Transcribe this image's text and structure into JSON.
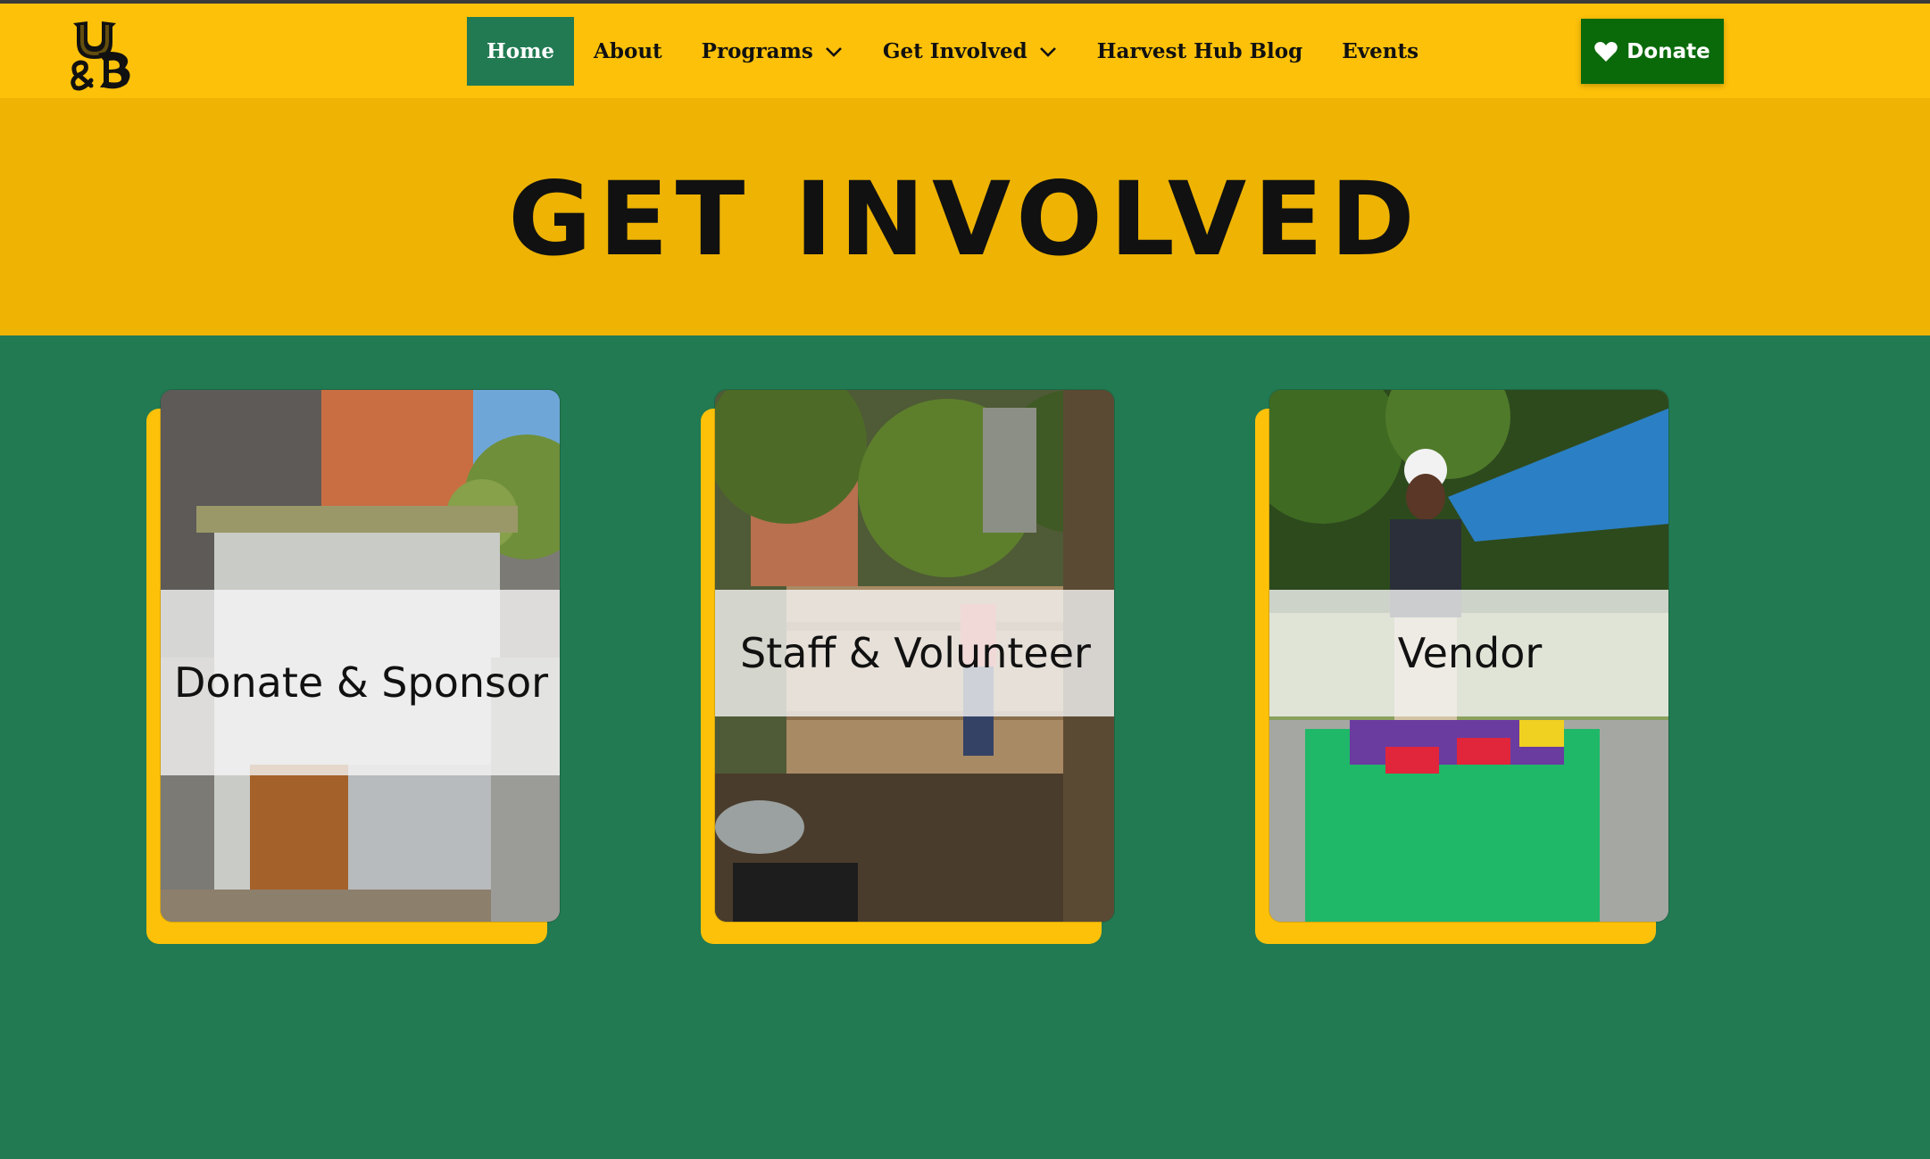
{
  "brand": {
    "logo_text": "U&B",
    "logo_icon": "ub-logo-icon"
  },
  "nav": {
    "items": [
      {
        "label": "Home",
        "active": true,
        "dropdown": false
      },
      {
        "label": "About",
        "active": false,
        "dropdown": false
      },
      {
        "label": "Programs",
        "active": false,
        "dropdown": true
      },
      {
        "label": "Get Involved",
        "active": false,
        "dropdown": true
      },
      {
        "label": "Harvest Hub Blog",
        "active": false,
        "dropdown": false
      },
      {
        "label": "Events",
        "active": false,
        "dropdown": false
      }
    ],
    "donate_label": "Donate",
    "donate_icon": "heart-icon"
  },
  "hero": {
    "title": "GET INVOLVED"
  },
  "cards": [
    {
      "label": "Donate & Sponsor",
      "image": "garden-shed-photo"
    },
    {
      "label": "Staff & Volunteer",
      "image": "volunteer-compost-photo"
    },
    {
      "label": "Vendor",
      "image": "vendor-market-photo"
    }
  ],
  "colors": {
    "nav_yellow": "#fdc10a",
    "hero_yellow": "#eeb303",
    "brand_green": "#217a52",
    "donate_green": "#0a6a0a"
  }
}
